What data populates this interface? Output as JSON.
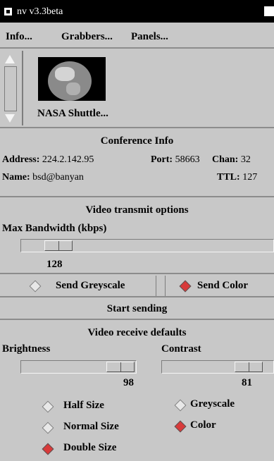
{
  "window": {
    "title": "nv v3.3beta"
  },
  "menu": {
    "items": [
      "Info...",
      "Grabbers...",
      "Panels..."
    ]
  },
  "source": {
    "label": "NASA Shuttle..."
  },
  "conference": {
    "heading": "Conference Info",
    "address_label": "Address:",
    "address": "224.2.142.95",
    "port_label": "Port:",
    "port": "58663",
    "chan_label": "Chan:",
    "chan": "32",
    "name_label": "Name:",
    "name": "bsd@banyan",
    "ttl_label": "TTL:",
    "ttl": "127"
  },
  "transmit": {
    "heading": "Video transmit options",
    "bandwidth_label": "Max Bandwidth (kbps)",
    "bandwidth_value": "128",
    "send_greyscale": "Send Greyscale",
    "send_color": "Send Color",
    "send_color_selected": true,
    "start_label": "Start sending"
  },
  "receive": {
    "heading": "Video receive defaults",
    "brightness_label": "Brightness",
    "brightness_value": "98",
    "contrast_label": "Contrast",
    "contrast_value": "81",
    "options": {
      "half_size": "Half Size",
      "normal_size": "Normal Size",
      "double_size": "Double Size",
      "greyscale": "Greyscale",
      "color": "Color"
    },
    "selected_size": "Double Size",
    "selected_mode": "Color"
  },
  "colors": {
    "selected_radio": "#d83a3a",
    "titlebar": "#000000",
    "panel": "#c8c8c8"
  }
}
